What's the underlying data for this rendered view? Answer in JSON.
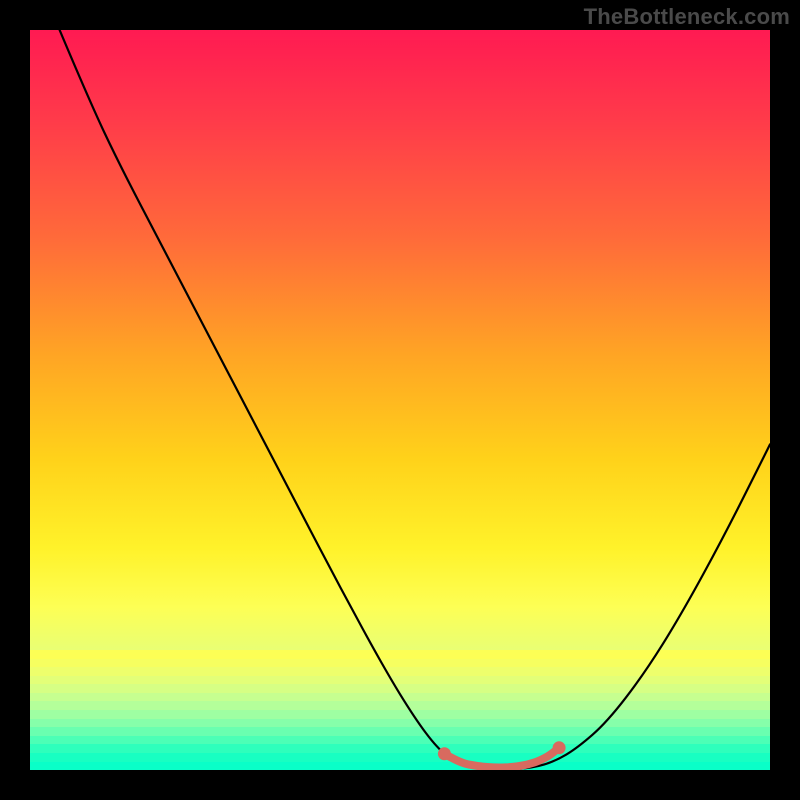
{
  "watermark": "TheBottleneck.com",
  "colors": {
    "border": "#000000",
    "curve": "#000000",
    "highlight": "#d86a5f",
    "gradient_top": "#ff1a52",
    "gradient_bottom": "#0affc8"
  },
  "chart_data": {
    "type": "line",
    "title": "",
    "xlabel": "",
    "ylabel": "",
    "xlim": [
      0,
      100
    ],
    "ylim": [
      0,
      100
    ],
    "grid": false,
    "curve_points": [
      {
        "x": 4.0,
        "y": 100.0
      },
      {
        "x": 8.0,
        "y": 90.5
      },
      {
        "x": 12.0,
        "y": 82.0
      },
      {
        "x": 18.0,
        "y": 70.5
      },
      {
        "x": 24.0,
        "y": 59.0
      },
      {
        "x": 30.0,
        "y": 47.5
      },
      {
        "x": 36.0,
        "y": 36.0
      },
      {
        "x": 42.0,
        "y": 24.5
      },
      {
        "x": 48.0,
        "y": 13.5
      },
      {
        "x": 52.0,
        "y": 7.0
      },
      {
        "x": 55.0,
        "y": 3.0
      },
      {
        "x": 57.5,
        "y": 1.0
      },
      {
        "x": 60.0,
        "y": 0.2
      },
      {
        "x": 64.0,
        "y": 0.0
      },
      {
        "x": 68.0,
        "y": 0.3
      },
      {
        "x": 71.0,
        "y": 1.2
      },
      {
        "x": 74.0,
        "y": 3.0
      },
      {
        "x": 78.0,
        "y": 6.5
      },
      {
        "x": 83.0,
        "y": 13.0
      },
      {
        "x": 88.0,
        "y": 21.0
      },
      {
        "x": 94.0,
        "y": 32.0
      },
      {
        "x": 100.0,
        "y": 44.0
      }
    ],
    "highlight_points": [
      {
        "x": 56.0,
        "y": 2.2
      },
      {
        "x": 58.0,
        "y": 1.0
      },
      {
        "x": 60.5,
        "y": 0.5
      },
      {
        "x": 63.0,
        "y": 0.3
      },
      {
        "x": 65.5,
        "y": 0.4
      },
      {
        "x": 68.0,
        "y": 0.9
      },
      {
        "x": 70.0,
        "y": 1.8
      },
      {
        "x": 71.5,
        "y": 3.0
      }
    ],
    "highlight_dots": [
      {
        "x": 56.0,
        "y": 2.2
      },
      {
        "x": 71.5,
        "y": 3.0
      }
    ],
    "background_bands": [
      "#fdff55",
      "#f6ff60",
      "#eeff6c",
      "#e3ff78",
      "#d6ff84",
      "#c6ff90",
      "#b4ff9a",
      "#9effa2",
      "#86ffaa",
      "#6affb0",
      "#4cffb6",
      "#2effbc",
      "#18ffc2",
      "#0affc8"
    ],
    "implied_minimum_x": 64,
    "implied_minimum_y": 0
  }
}
